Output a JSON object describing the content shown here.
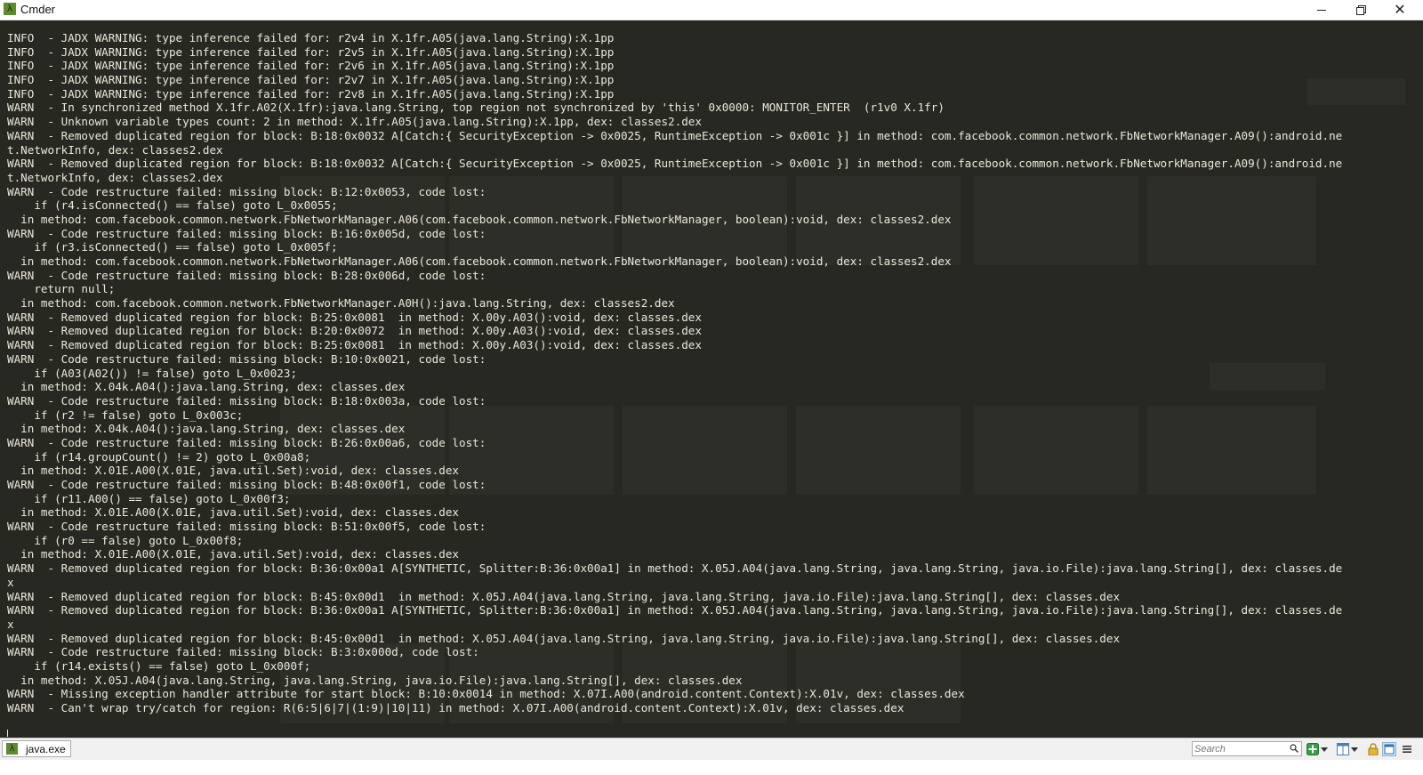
{
  "window": {
    "title": "Cmder",
    "app_icon_glyph": "λ",
    "controls": {
      "minimize": "minimize-icon",
      "maximize": "restore-icon",
      "close": "close-icon"
    }
  },
  "console": {
    "lines": [
      "INFO  - JADX WARNING: type inference failed for: r2v4 in X.1fr.A05(java.lang.String):X.1pp",
      "INFO  - JADX WARNING: type inference failed for: r2v5 in X.1fr.A05(java.lang.String):X.1pp",
      "INFO  - JADX WARNING: type inference failed for: r2v6 in X.1fr.A05(java.lang.String):X.1pp",
      "INFO  - JADX WARNING: type inference failed for: r2v7 in X.1fr.A05(java.lang.String):X.1pp",
      "INFO  - JADX WARNING: type inference failed for: r2v8 in X.1fr.A05(java.lang.String):X.1pp",
      "WARN  - In synchronized method X.1fr.A02(X.1fr):java.lang.String, top region not synchronized by 'this' 0x0000: MONITOR_ENTER  (r1v0 X.1fr)",
      "WARN  - Unknown variable types count: 2 in method: X.1fr.A05(java.lang.String):X.1pp, dex: classes2.dex",
      "WARN  - Removed duplicated region for block: B:18:0x0032 A[Catch:{ SecurityException -> 0x0025, RuntimeException -> 0x001c }] in method: com.facebook.common.network.FbNetworkManager.A09():android.ne",
      "t.NetworkInfo, dex: classes2.dex",
      "WARN  - Removed duplicated region for block: B:18:0x0032 A[Catch:{ SecurityException -> 0x0025, RuntimeException -> 0x001c }] in method: com.facebook.common.network.FbNetworkManager.A09():android.ne",
      "t.NetworkInfo, dex: classes2.dex",
      "WARN  - Code restructure failed: missing block: B:12:0x0053, code lost:",
      "    if (r4.isConnected() == false) goto L_0x0055;",
      "  in method: com.facebook.common.network.FbNetworkManager.A06(com.facebook.common.network.FbNetworkManager, boolean):void, dex: classes2.dex",
      "WARN  - Code restructure failed: missing block: B:16:0x005d, code lost:",
      "    if (r3.isConnected() == false) goto L_0x005f;",
      "  in method: com.facebook.common.network.FbNetworkManager.A06(com.facebook.common.network.FbNetworkManager, boolean):void, dex: classes2.dex",
      "WARN  - Code restructure failed: missing block: B:28:0x006d, code lost:",
      "    return null;",
      "  in method: com.facebook.common.network.FbNetworkManager.A0H():java.lang.String, dex: classes2.dex",
      "WARN  - Removed duplicated region for block: B:25:0x0081  in method: X.00y.A03():void, dex: classes.dex",
      "WARN  - Removed duplicated region for block: B:20:0x0072  in method: X.00y.A03():void, dex: classes.dex",
      "WARN  - Removed duplicated region for block: B:25:0x0081  in method: X.00y.A03():void, dex: classes.dex",
      "WARN  - Code restructure failed: missing block: B:10:0x0021, code lost:",
      "    if (A03(A02()) != false) goto L_0x0023;",
      "  in method: X.04k.A04():java.lang.String, dex: classes.dex",
      "WARN  - Code restructure failed: missing block: B:18:0x003a, code lost:",
      "    if (r2 != false) goto L_0x003c;",
      "  in method: X.04k.A04():java.lang.String, dex: classes.dex",
      "WARN  - Code restructure failed: missing block: B:26:0x00a6, code lost:",
      "    if (r14.groupCount() != 2) goto L_0x00a8;",
      "  in method: X.01E.A00(X.01E, java.util.Set):void, dex: classes.dex",
      "WARN  - Code restructure failed: missing block: B:48:0x00f1, code lost:",
      "    if (r11.A00() == false) goto L_0x00f3;",
      "  in method: X.01E.A00(X.01E, java.util.Set):void, dex: classes.dex",
      "WARN  - Code restructure failed: missing block: B:51:0x00f5, code lost:",
      "    if (r0 == false) goto L_0x00f8;",
      "  in method: X.01E.A00(X.01E, java.util.Set):void, dex: classes.dex",
      "WARN  - Removed duplicated region for block: B:36:0x00a1 A[SYNTHETIC, Splitter:B:36:0x00a1] in method: X.05J.A04(java.lang.String, java.lang.String, java.io.File):java.lang.String[], dex: classes.de",
      "x",
      "WARN  - Removed duplicated region for block: B:45:0x00d1  in method: X.05J.A04(java.lang.String, java.lang.String, java.io.File):java.lang.String[], dex: classes.dex",
      "WARN  - Removed duplicated region for block: B:36:0x00a1 A[SYNTHETIC, Splitter:B:36:0x00a1] in method: X.05J.A04(java.lang.String, java.lang.String, java.io.File):java.lang.String[], dex: classes.de",
      "x",
      "WARN  - Removed duplicated region for block: B:45:0x00d1  in method: X.05J.A04(java.lang.String, java.lang.String, java.io.File):java.lang.String[], dex: classes.dex",
      "WARN  - Code restructure failed: missing block: B:3:0x000d, code lost:",
      "    if (r14.exists() == false) goto L_0x000f;",
      "  in method: X.05J.A04(java.lang.String, java.lang.String, java.io.File):java.lang.String[], dex: classes.dex",
      "WARN  - Missing exception handler attribute for start block: B:10:0x0014 in method: X.07I.A00(android.content.Context):X.01v, dex: classes.dex",
      "WARN  - Can't wrap try/catch for region: R(6:5|6|7|(1:9)|10|11) in method: X.07I.A00(android.content.Context):X.01v, dex: classes.dex"
    ]
  },
  "statusbar": {
    "tab_label": "java.exe",
    "tab_icon_glyph": "λ",
    "search_placeholder": "Search",
    "icons": [
      "search-icon",
      "plus-icon",
      "chevron-down-icon",
      "split-icon",
      "lock-icon",
      "view-icon",
      "menu-icon"
    ]
  },
  "colors": {
    "console_bg": "#272822",
    "console_fg": "#ece8d8",
    "accent_green": "#5d8b2e",
    "titlebar_bg": "#ffffff",
    "statusbar_bg": "#f0f0f0"
  }
}
